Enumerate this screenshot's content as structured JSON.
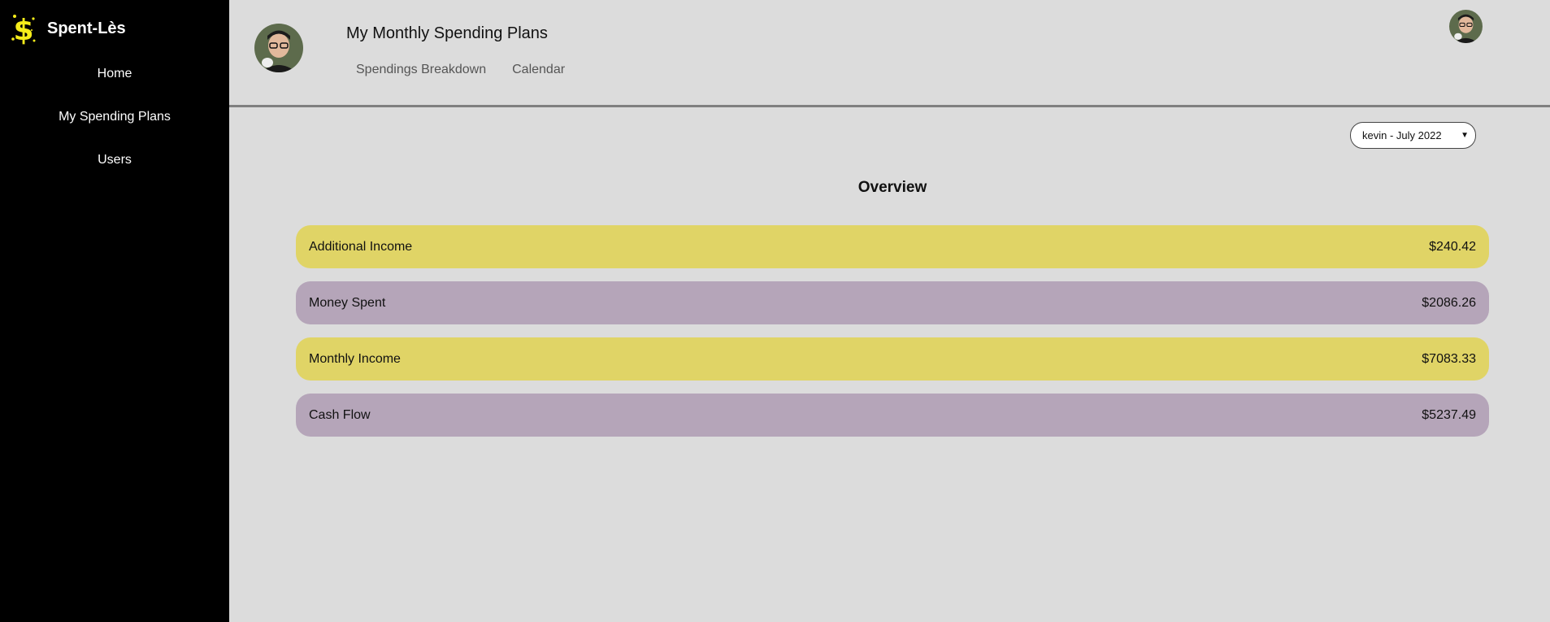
{
  "app": {
    "name": "Spent-Lès",
    "logo_icon": "dollar-sign-icon",
    "logo_color": "#f5ec1a"
  },
  "sidebar": {
    "items": [
      {
        "label": "Home"
      },
      {
        "label": "My Spending Plans"
      },
      {
        "label": "Users"
      }
    ]
  },
  "header": {
    "title": "My Monthly Spending Plans",
    "tabs": [
      {
        "label": "Spendings Breakdown"
      },
      {
        "label": "Calendar"
      }
    ]
  },
  "plan_select": {
    "selected": "kevin - July 2022"
  },
  "overview": {
    "title": "Overview",
    "rows": [
      {
        "label": "Additional Income",
        "value": "$240.42",
        "color": "#e0d466"
      },
      {
        "label": "Money Spent",
        "value": "$2086.26",
        "color": "#b5a5b9"
      },
      {
        "label": "Monthly Income",
        "value": "$7083.33",
        "color": "#e0d466"
      },
      {
        "label": "Cash Flow",
        "value": "$5237.49",
        "color": "#b5a5b9"
      }
    ]
  }
}
